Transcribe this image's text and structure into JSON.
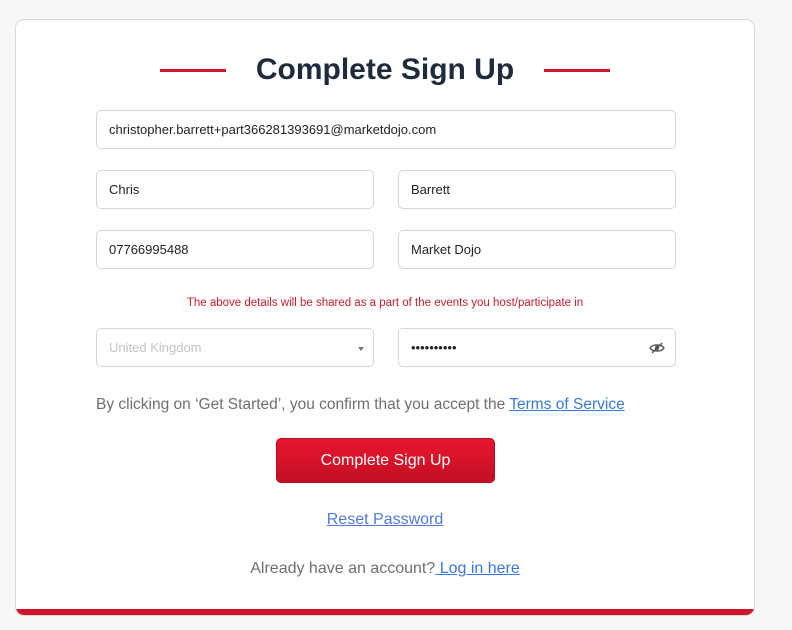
{
  "page": {
    "title": "Complete Sign Up",
    "accent_color": "#d0142a"
  },
  "form": {
    "email": "christopher.barrett+part366281393691@marketdojo.com",
    "first_name": "Chris",
    "last_name": "Barrett",
    "phone": "07766995488",
    "company": "Market Dojo",
    "notice": "The above details will be shared as a part of the events you host/participate in",
    "country": "United Kingdom",
    "password": "••••••••••",
    "password_toggle_icon": "eye-slash-icon",
    "country_caret_icon": "caret-down-icon"
  },
  "consent": {
    "text": "By clicking on ‘Get Started’, you confirm that you accept the ",
    "terms_link": "Terms of Service"
  },
  "actions": {
    "submit_label": "Complete Sign Up",
    "reset_password": "Reset Password",
    "login_prompt": "Already have an account?",
    "login_link": " Log in here"
  }
}
